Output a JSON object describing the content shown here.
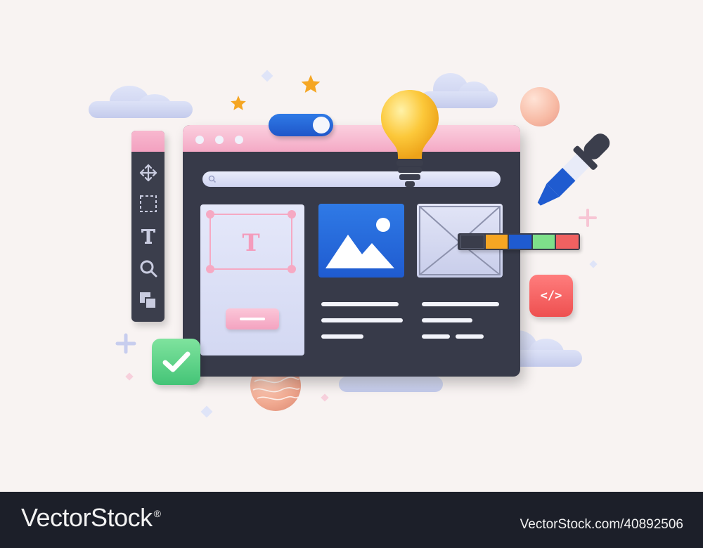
{
  "illustration": {
    "tools": [
      "move-icon",
      "marquee-select-icon",
      "text-tool-icon",
      "zoom-icon",
      "layers-icon"
    ],
    "text_card_letter": "T",
    "code_badge_label": "</>",
    "toggle_state": "on",
    "color_swatches": [
      "#3a3d4b",
      "#f6a623",
      "#1f5bd0",
      "#7ee08a",
      "#f06161"
    ],
    "colors": {
      "window_body": "#373a49",
      "titlebar_pink": "#f4a9c5",
      "accent_blue": "#1f5bd0",
      "check_green": "#44c477",
      "code_red": "#ee5050",
      "bulb_yellow": "#fbc02d"
    }
  },
  "footer": {
    "brand": "VectorStock",
    "registered_mark": "®",
    "asset_id": "VectorStock.com/40892506"
  }
}
